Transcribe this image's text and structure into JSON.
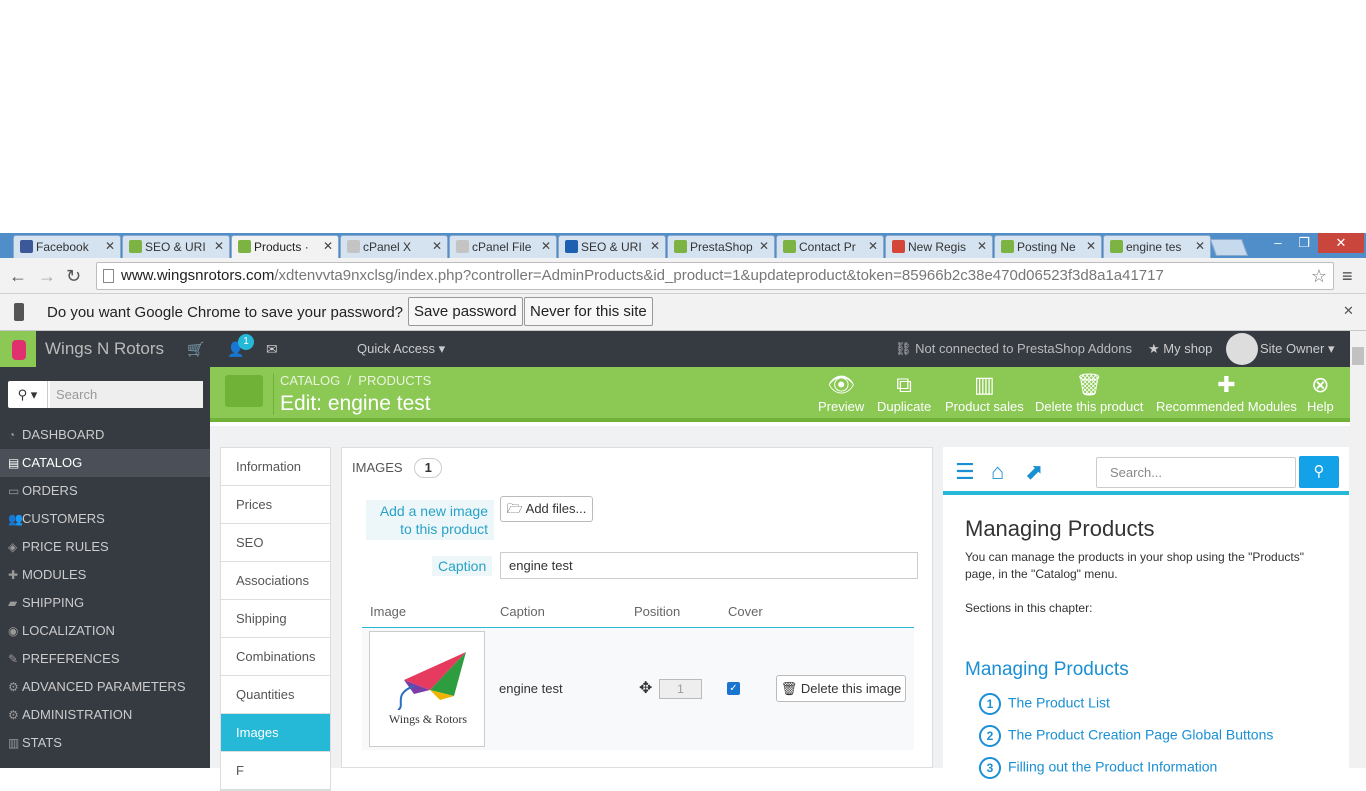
{
  "browser": {
    "tabs": [
      {
        "title": "Facebook",
        "color": "#3b5998"
      },
      {
        "title": "SEO & URI",
        "color": "#7cb342"
      },
      {
        "title": "Products ·",
        "color": "#7cb342",
        "active": true
      },
      {
        "title": "cPanel X",
        "color": "#c4c4c4"
      },
      {
        "title": "cPanel File",
        "color": "#c4c4c4"
      },
      {
        "title": "SEO & URI",
        "color": "#1d5fb0"
      },
      {
        "title": "PrestaShop",
        "color": "#7cb342"
      },
      {
        "title": "Contact Pr",
        "color": "#7cb342"
      },
      {
        "title": "New Regis",
        "color": "#d44638"
      },
      {
        "title": "Posting Ne",
        "color": "#7cb342"
      },
      {
        "title": "engine tes",
        "color": "#7cb342"
      }
    ],
    "url_domain": "www.wingsnrotors.com",
    "url_path": "/xdtenvvta9nxclsg/index.php?controller=AdminProducts&id_product=1&updateproduct&token=85966b2c38e470d06523f3d8a1a41717"
  },
  "password_bar": {
    "message": "Do you want Google Chrome to save your password?",
    "save_label": "Save password",
    "never_label": "Never for this site"
  },
  "header": {
    "shop_name": "Wings N Rotors",
    "notifications": "1",
    "quick_access": "Quick Access",
    "addons": "Not connected to PrestaShop Addons",
    "my_shop": "My shop",
    "owner": "Site Owner"
  },
  "sidebar": {
    "search_placeholder": "Search",
    "items": [
      {
        "label": "DASHBOARD",
        "icon": "dashboard-icon"
      },
      {
        "label": "CATALOG",
        "icon": "book-icon",
        "active": true
      },
      {
        "label": "ORDERS",
        "icon": "credit-card-icon"
      },
      {
        "label": "CUSTOMERS",
        "icon": "users-icon"
      },
      {
        "label": "PRICE RULES",
        "icon": "tag-icon"
      },
      {
        "label": "MODULES",
        "icon": "puzzle-icon"
      },
      {
        "label": "SHIPPING",
        "icon": "truck-icon"
      },
      {
        "label": "LOCALIZATION",
        "icon": "globe-icon"
      },
      {
        "label": "PREFERENCES",
        "icon": "wrench-icon"
      },
      {
        "label": "ADVANCED PARAMETERS",
        "icon": "cogs-icon"
      },
      {
        "label": "ADMINISTRATION",
        "icon": "cog-icon"
      },
      {
        "label": "STATS",
        "icon": "bar-chart-icon"
      }
    ]
  },
  "page_head": {
    "crumb1": "CATALOG",
    "crumb_sep": "/",
    "crumb2": "PRODUCTS",
    "title": "Edit: engine test",
    "actions": [
      {
        "label": "Preview",
        "icon": "eye-icon"
      },
      {
        "label": "Duplicate",
        "icon": "copy-icon"
      },
      {
        "label": "Product sales",
        "icon": "bar-chart-icon"
      },
      {
        "label": "Delete this product",
        "icon": "trash-icon"
      },
      {
        "label": "Recommended Modules",
        "icon": "puzzle-icon"
      },
      {
        "label": "Help",
        "icon": "help-icon"
      }
    ]
  },
  "product_tabs": [
    "Information",
    "Prices",
    "SEO",
    "Associations",
    "Shipping",
    "Combinations",
    "Quantities",
    "Images",
    "F"
  ],
  "images_panel": {
    "heading": "IMAGES",
    "count": "1",
    "add_label": "Add a new image to this product",
    "add_button": "Add files...",
    "caption_label": "Caption",
    "caption_value": "engine test",
    "columns": [
      "Image",
      "Caption",
      "Position",
      "Cover"
    ],
    "row": {
      "logo_text": "Wings & Rotors",
      "caption": "engine test",
      "position": "1",
      "delete_label": "Delete this image"
    }
  },
  "help_panel": {
    "search_placeholder": "Search...",
    "title": "Managing Products",
    "paragraph": "You can manage the products in your shop using the \"Products\" page, in the \"Catalog\" menu.",
    "sections_label": "Sections in this chapter:",
    "subtitle": "Managing Products",
    "items": [
      {
        "num": "1",
        "label": "The Product List"
      },
      {
        "num": "2",
        "label": "The Product Creation Page Global Buttons"
      },
      {
        "num": "3",
        "label": "Filling out the Product Information"
      }
    ]
  }
}
